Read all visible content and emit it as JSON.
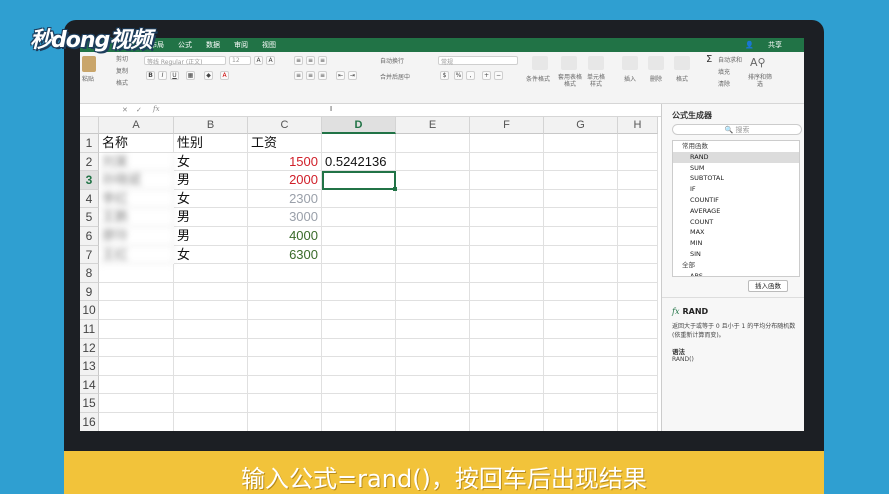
{
  "logo": "秒dong视频",
  "tabs": [
    "布局",
    "公式",
    "数据",
    "审阅",
    "视图"
  ],
  "share_label": "共享",
  "ribbon": {
    "paste": "粘贴",
    "cut": "剪切",
    "copy": "复制",
    "format_painter": "格式",
    "font_name": "等线 Regular (正文)",
    "font_size": "12",
    "wrap_text": "自动换行",
    "merge_center": "合并后居中",
    "number_format": "常规",
    "conditional_format": "条件格式",
    "table_format": "套用表格格式",
    "cell_style": "单元格样式",
    "insert": "插入",
    "delete": "删除",
    "format": "格式",
    "autosum": "自动求和",
    "fill": "填充",
    "clear": "清除",
    "sort_filter": "排序和筛选"
  },
  "formula_bar": {
    "cancel": "✕",
    "confirm": "✓",
    "fx": "fx",
    "content": "I"
  },
  "columns": [
    "A",
    "B",
    "C",
    "D",
    "E",
    "F",
    "G",
    "H"
  ],
  "selected_column": "D",
  "rows": [
    "1",
    "2",
    "3",
    "4",
    "5",
    "6",
    "7",
    "8",
    "9",
    "10",
    "11",
    "12",
    "13",
    "14",
    "15",
    "16"
  ],
  "selected_row": "3",
  "cells": {
    "A1": "名称",
    "B1": "性别",
    "C1": "工资",
    "A2": "刘某",
    "B2": "女",
    "C2": "1500",
    "D2": "0.5242136",
    "A3": "孙晓斌",
    "B3": "男",
    "C3": "2000",
    "A4": "李红",
    "B4": "女",
    "C4": "2300",
    "A5": "王鹏",
    "B5": "男",
    "C5": "3000",
    "A6": "廖玲",
    "B6": "男",
    "C6": "4000",
    "A7": "王红",
    "B7": "女",
    "C7": "6300"
  },
  "salary_colors": {
    "C2": "#d0202a",
    "C3": "#d0202a",
    "C4": "#9aa0aa",
    "C5": "#9aa0aa",
    "C6": "#3a6b2a",
    "C7": "#3a6b2a"
  },
  "panel": {
    "title": "公式生成器",
    "search_placeholder": "搜索",
    "groups": [
      {
        "label": "常用函数",
        "items": [
          "RAND",
          "SUM",
          "SUBTOTAL",
          "IF",
          "COUNTIF",
          "AVERAGE",
          "COUNT",
          "MAX",
          "MIN",
          "SIN"
        ]
      },
      {
        "label": "全部",
        "items": [
          "ABS"
        ]
      }
    ],
    "selected_function": "RAND",
    "insert_button": "插入函数",
    "function_name": "RAND",
    "description": "返回大于或等于 0 且小于 1 的平均分布随机数(依重新计算而变)。",
    "syntax_label": "语法",
    "syntax": "RAND()"
  },
  "caption": "输入公式=rand()，按回车后出现结果"
}
